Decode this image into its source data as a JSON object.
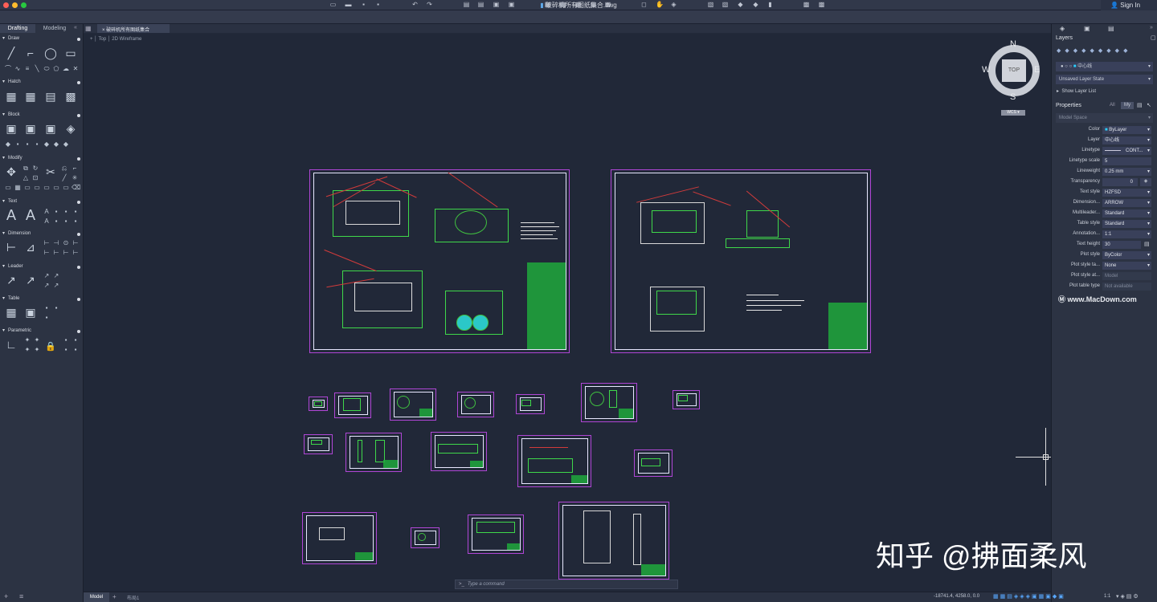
{
  "window": {
    "title": "破碎机所有图纸集合.dwg",
    "sign_in": "Sign In"
  },
  "document": {
    "tab": "破碎机所有图纸集合"
  },
  "viewport": {
    "view": "Top",
    "style": "2D Wireframe",
    "plus": "+"
  },
  "left_panel": {
    "tabs": [
      "Drafting",
      "Modeling"
    ],
    "sections": [
      "Draw",
      "Hatch",
      "Block",
      "Modify",
      "Text",
      "Dimension",
      "Leader",
      "Table",
      "Parametric"
    ]
  },
  "compass": {
    "n": "N",
    "s": "S",
    "e": "E",
    "w": "W",
    "cube": "TOP",
    "wcs": "WCS"
  },
  "right_panel": {
    "layers": {
      "title": "Layers",
      "current": "中心线",
      "state": "Unsaved Layer State",
      "show_list": "Show Layer List"
    },
    "properties": {
      "title": "Properties",
      "filter_all": "All",
      "filter_my": "My",
      "space": "Model Space",
      "rows": [
        {
          "label": "Color",
          "value": "ByLayer"
        },
        {
          "label": "Layer",
          "value": "中心线"
        },
        {
          "label": "Linetype",
          "value": "CONT..."
        },
        {
          "label": "Linetype scale",
          "value": "5"
        },
        {
          "label": "Lineweight",
          "value": "0.25 mm"
        },
        {
          "label": "Transparency",
          "value": "0"
        },
        {
          "label": "Text style",
          "value": "HZFSD"
        },
        {
          "label": "Dimension...",
          "value": "ARROW"
        },
        {
          "label": "Multileader...",
          "value": "Standard"
        },
        {
          "label": "Table style",
          "value": "Standard"
        },
        {
          "label": "Annotation...",
          "value": "1:1"
        },
        {
          "label": "Text height",
          "value": "30"
        },
        {
          "label": "Plot style",
          "value": "ByColor"
        },
        {
          "label": "Plot style ta...",
          "value": "None"
        },
        {
          "label": "Plot style at...",
          "value": "Model"
        },
        {
          "label": "Plot table type",
          "value": "Not available"
        }
      ]
    },
    "macdown": "www.MacDown.com"
  },
  "command": {
    "placeholder": "Type a command",
    "prompt": ">_"
  },
  "status": {
    "tabs": [
      "Model",
      "布局1"
    ],
    "coords": "-18741.4, 4258.0, 0.0",
    "scale": "1:1"
  },
  "watermark": "知乎 @拂面柔风"
}
